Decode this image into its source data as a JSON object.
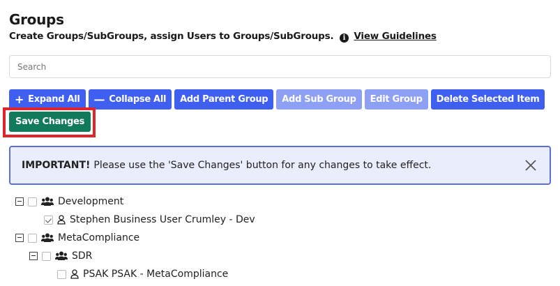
{
  "header": {
    "title": "Groups",
    "subtitle": "Create Groups/SubGroups, assign Users to Groups/SubGroups.",
    "info_glyph": "i",
    "guidelines_link": "View Guidelines"
  },
  "search": {
    "placeholder": "Search",
    "value": ""
  },
  "toolbar": {
    "expand_all": "Expand All",
    "collapse_all": "Collapse All",
    "add_parent_group": "Add Parent Group",
    "add_sub_group": "Add Sub Group",
    "edit_group": "Edit Group",
    "delete_selected": "Delete Selected Item",
    "save_changes": "Save Changes"
  },
  "alert": {
    "strong": "IMPORTANT!",
    "message": "Please use the 'Save Changes' button for any changes to take effect."
  },
  "tree": {
    "nodes": [
      {
        "label": "Development",
        "type": "group",
        "checked": false
      },
      {
        "label": "Stephen Business User Crumley - Dev",
        "type": "user",
        "checked": true
      },
      {
        "label": "MetaCompliance",
        "type": "group",
        "checked": false
      },
      {
        "label": "SDR",
        "type": "group",
        "checked": false
      },
      {
        "label": "PSAK PSAK - MetaCompliance",
        "type": "user",
        "checked": false
      }
    ]
  },
  "colors": {
    "primary": "#3f5ff0",
    "primary_disabled": "#8ea0f3",
    "success": "#117a5a",
    "highlight": "#e0242b",
    "alert_bg": "#eaedfb",
    "alert_border": "#5a6fd8"
  }
}
